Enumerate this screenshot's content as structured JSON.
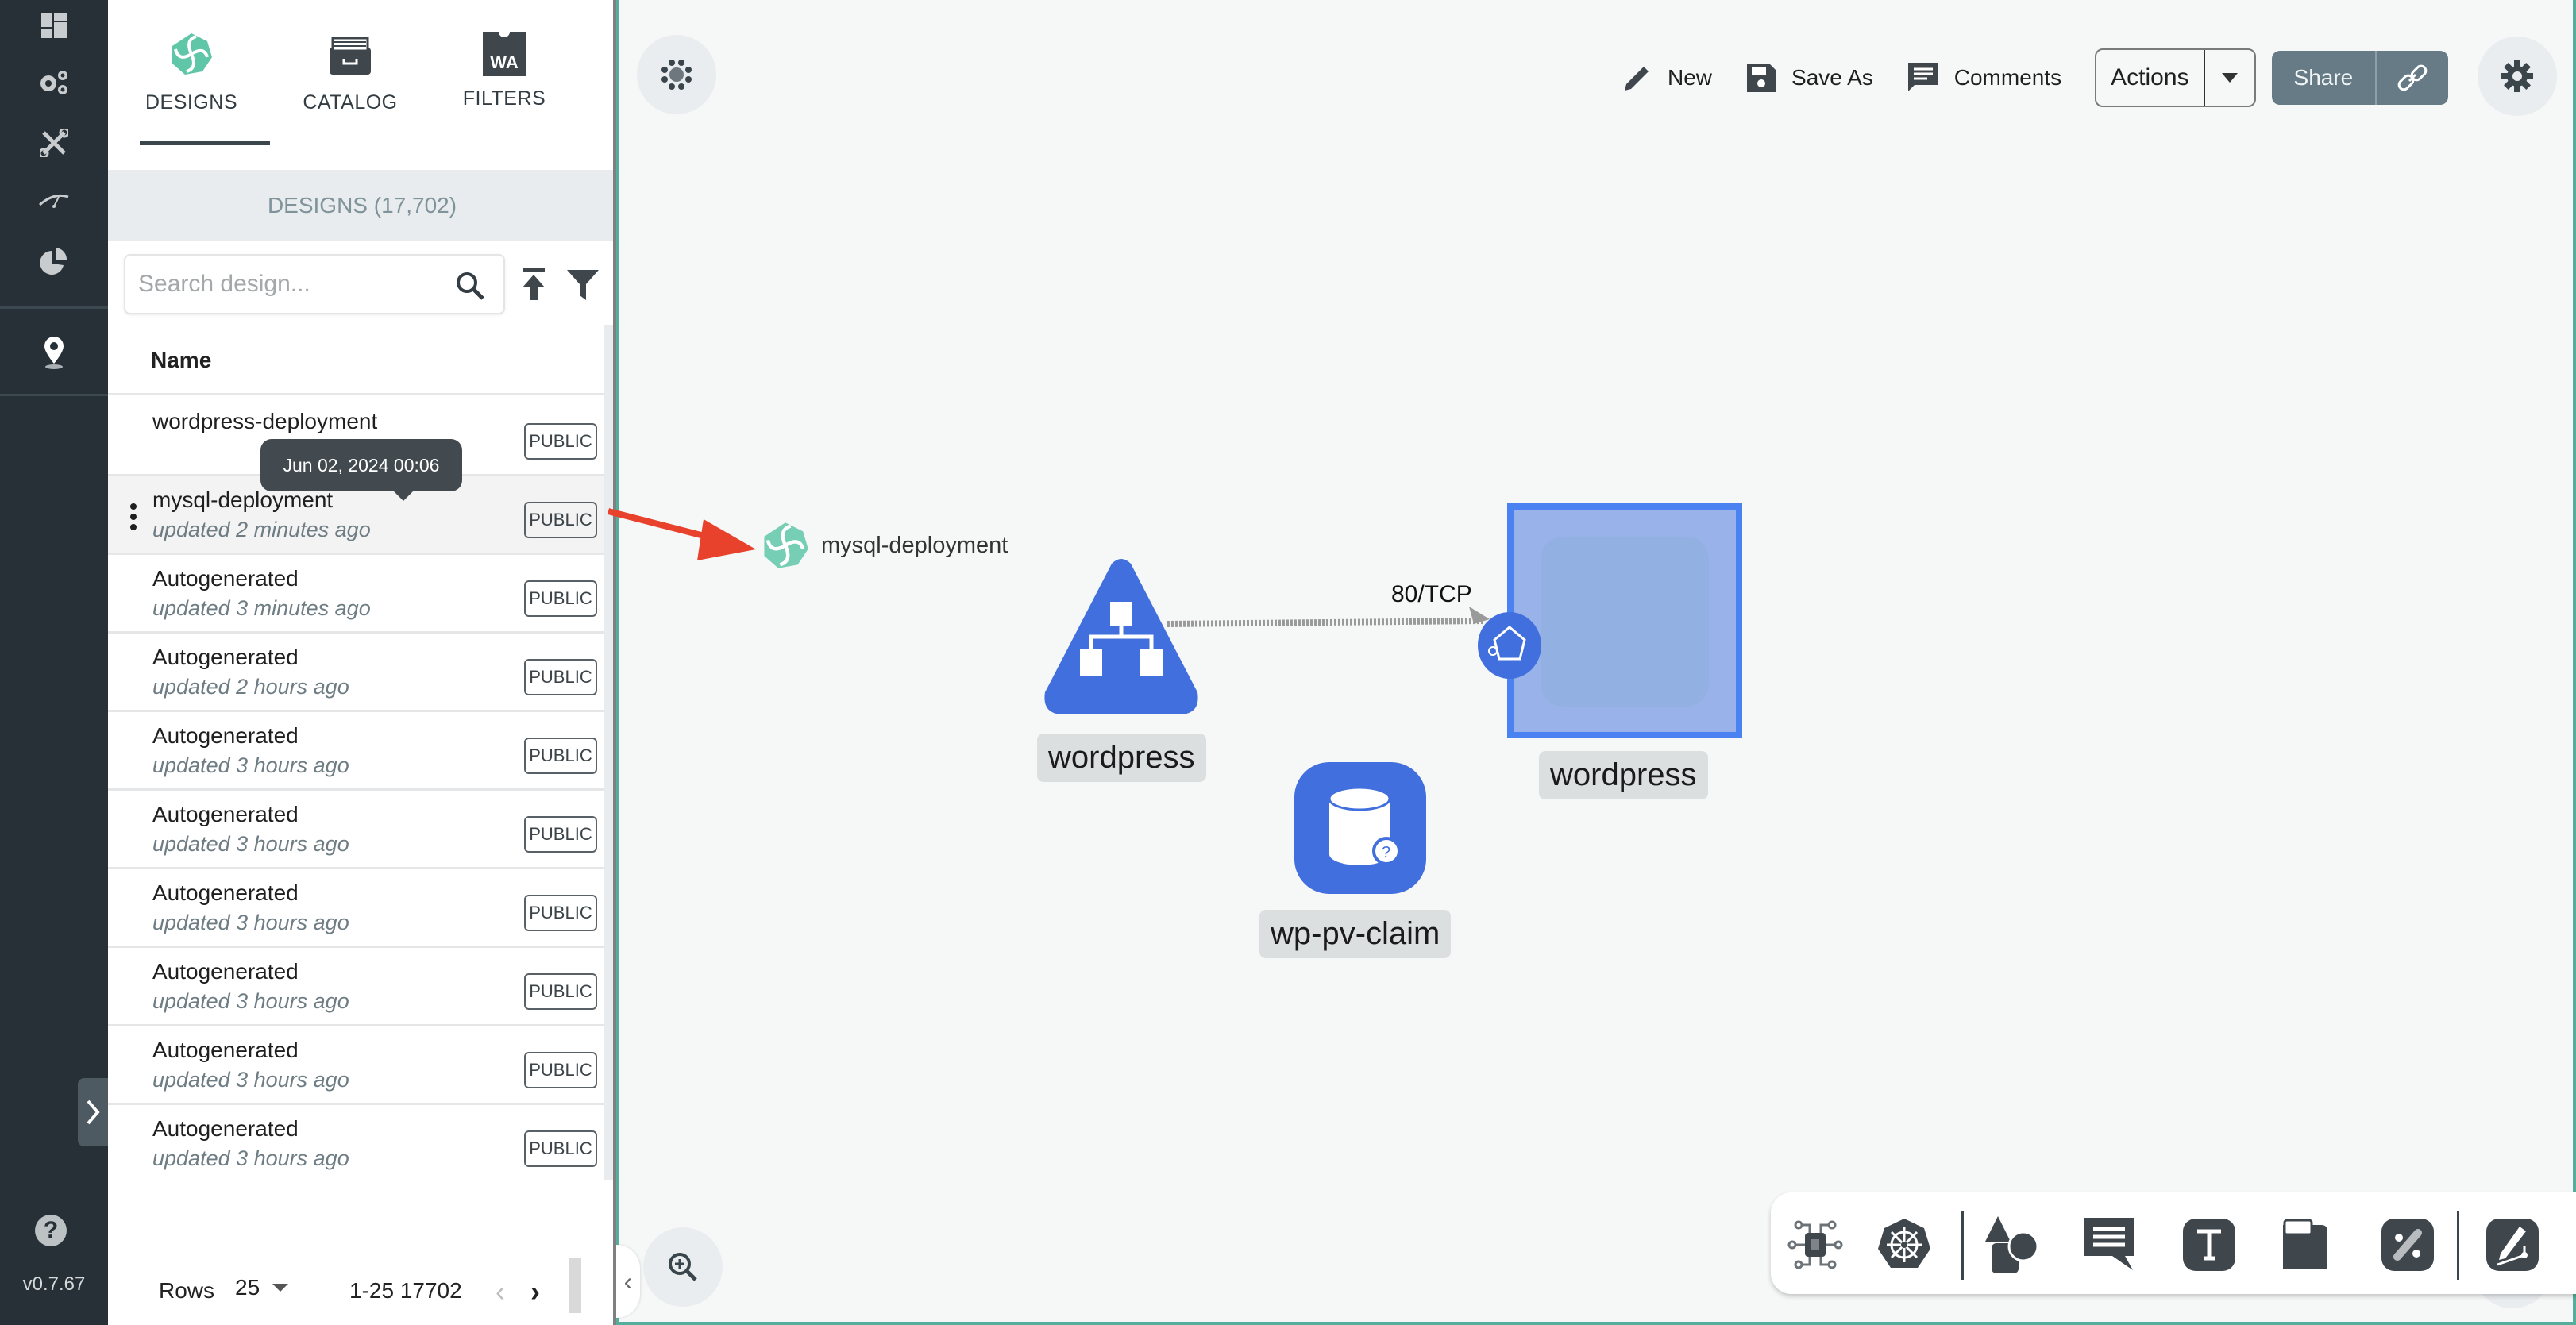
{
  "nav": {
    "items": [
      {
        "name": "dashboard",
        "icon": "dashboard-icon"
      },
      {
        "name": "lifecycle",
        "icon": "gears-icon"
      },
      {
        "name": "configuration",
        "icon": "tools-icon"
      },
      {
        "name": "performance",
        "icon": "gauge-icon"
      },
      {
        "name": "extensions",
        "icon": "pie-chart-icon"
      },
      {
        "name": "location",
        "icon": "location-pin-icon"
      }
    ],
    "help_icon": "?",
    "version": "v0.7.67"
  },
  "panel": {
    "tabs": [
      {
        "label": "DESIGNS",
        "icon": "designs-logo-icon",
        "active": true
      },
      {
        "label": "CATALOG",
        "icon": "catalog-drawer-icon",
        "active": false
      },
      {
        "label": "FILTERS",
        "icon": "wasm-filter-icon",
        "active": false
      }
    ],
    "wa_glyph": "WA",
    "designs_header": "DESIGNS (17,702)",
    "search": {
      "placeholder": "Search design...",
      "value": ""
    },
    "table": {
      "column_name": "Name",
      "rows": [
        {
          "name": "wordpress-deployment",
          "updated": "",
          "visibility": "PUBLIC"
        },
        {
          "name": "mysql-deployment",
          "updated": "updated 2 minutes ago",
          "visibility": "PUBLIC",
          "highlighted": true
        },
        {
          "name": "Autogenerated",
          "updated": "updated 3 minutes ago",
          "visibility": "PUBLIC"
        },
        {
          "name": "Autogenerated",
          "updated": "updated 2 hours ago",
          "visibility": "PUBLIC"
        },
        {
          "name": "Autogenerated",
          "updated": "updated 3 hours ago",
          "visibility": "PUBLIC"
        },
        {
          "name": "Autogenerated",
          "updated": "updated 3 hours ago",
          "visibility": "PUBLIC"
        },
        {
          "name": "Autogenerated",
          "updated": "updated 3 hours ago",
          "visibility": "PUBLIC"
        },
        {
          "name": "Autogenerated",
          "updated": "updated 3 hours ago",
          "visibility": "PUBLIC"
        },
        {
          "name": "Autogenerated",
          "updated": "updated 3 hours ago",
          "visibility": "PUBLIC"
        },
        {
          "name": "Autogenerated",
          "updated": "updated 3 hours ago",
          "visibility": "PUBLIC"
        }
      ]
    },
    "tooltip": "Jun 02, 2024 00:06",
    "pagination": {
      "rows_label": "Rows",
      "rows_per_page": "25",
      "range": "1-25 17702",
      "prev": "‹",
      "next": "›"
    }
  },
  "toolbar": {
    "new_label": "New",
    "save_as_label": "Save As",
    "comments_label": "Comments",
    "actions_label": "Actions",
    "share_label": "Share"
  },
  "canvas": {
    "dragged_design_label": "mysql-deployment",
    "nodes": {
      "service_label": "wordpress",
      "deployment_label": "wordpress",
      "pvc_label": "wp-pv-claim"
    },
    "edge_label": "80/TCP"
  },
  "colors": {
    "accent": "#55ad9c",
    "node_blue": "#416fde",
    "rail_bg": "#263036",
    "share_bg": "#667b86",
    "arrow_red": "#e8412c"
  }
}
